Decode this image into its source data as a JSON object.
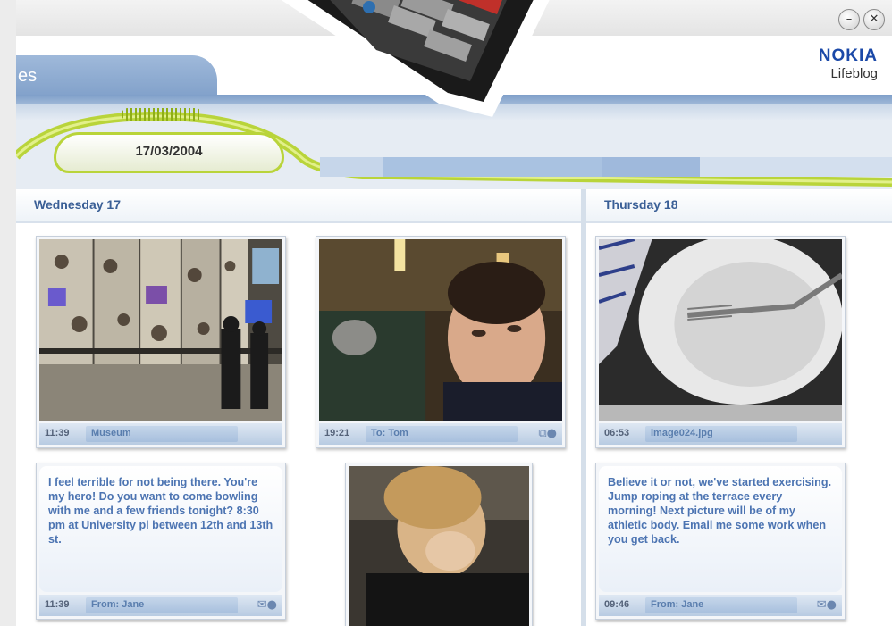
{
  "window": {
    "minimize_glyph": "–",
    "close_glyph": "✕"
  },
  "header": {
    "tab_fragment": "es",
    "brand": "NOKIA",
    "product": "Lifeblog"
  },
  "date_selector": {
    "date": "17/03/2004"
  },
  "days": [
    {
      "title": "Wednesday 17",
      "items": [
        {
          "time": "11:39",
          "label": "Museum",
          "kind": "photo",
          "icon": "none"
        },
        {
          "time": "19:21",
          "label": "To: Tom",
          "kind": "photo",
          "icon": "mms-icon"
        },
        {
          "time": "11:39",
          "label": "From: Jane",
          "kind": "message",
          "icon": "envelope-icon",
          "text": "I feel terrible for not being there. You're my hero! Do you want to come bowling with me and a few friends tonight? 8:30 pm at University pl between 12th and 13th st."
        },
        {
          "kind": "photo"
        }
      ]
    },
    {
      "title": "Thursday 18",
      "items": [
        {
          "time": "06:53",
          "label": "image024.jpg",
          "kind": "photo",
          "icon": "none"
        },
        {
          "time": "09:46",
          "label": "From: Jane",
          "kind": "message",
          "icon": "envelope-icon",
          "text": "Believe it or not, we've started exercising. Jump roping at the terrace every morning! Next picture will be of my athletic body. Email me some work when you get back."
        }
      ]
    }
  ],
  "colors": {
    "accent_green": "#b9d43a",
    "brand_blue": "#1b49a8",
    "caption_text": "#4c74b2"
  }
}
